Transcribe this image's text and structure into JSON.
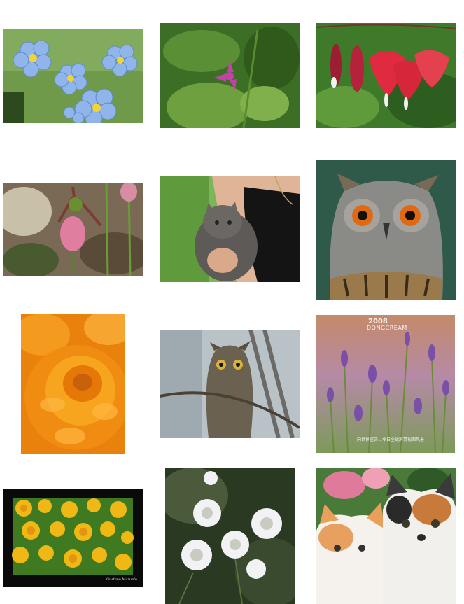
{
  "gallery": {
    "images": [
      {
        "name": "blue-forget-me-not-flowers",
        "caption": ""
      },
      {
        "name": "pink-wildflower-in-leaves",
        "caption": ""
      },
      {
        "name": "bleeding-heart-flowers",
        "caption": ""
      },
      {
        "name": "pink-ladys-slipper-orchid",
        "caption": ""
      },
      {
        "name": "kitten-held-by-woman",
        "caption": ""
      },
      {
        "name": "eagle-owl-portrait",
        "caption": ""
      },
      {
        "name": "orange-marigold-closeup",
        "caption": ""
      },
      {
        "name": "screech-owl-on-branch",
        "caption": ""
      },
      {
        "name": "purple-lavender-field",
        "caption": ""
      },
      {
        "name": "yellow-marigold-bed",
        "caption": ""
      },
      {
        "name": "white-queen-annes-lace",
        "caption": ""
      },
      {
        "name": "calico-kittens-pair",
        "caption": ""
      }
    ],
    "watermarks": {
      "lavender_year": "2008",
      "lavender_brand": "DONGCREAM",
      "lavender_footer": "向世界宣告…今日全球屏幕视图风景",
      "marigold_signature": "Gustavo Mazuelo"
    }
  }
}
